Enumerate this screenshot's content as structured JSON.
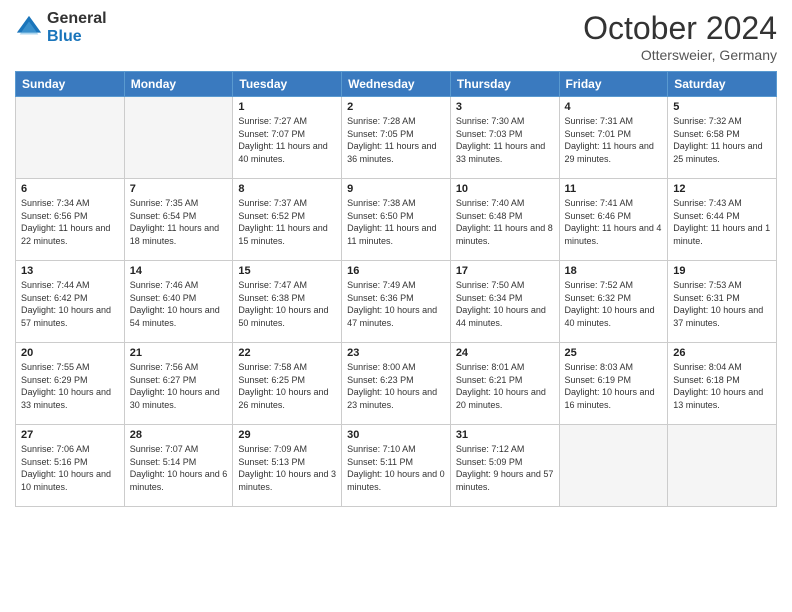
{
  "header": {
    "logo_general": "General",
    "logo_blue": "Blue",
    "month_title": "October 2024",
    "location": "Ottersweier, Germany"
  },
  "days_of_week": [
    "Sunday",
    "Monday",
    "Tuesday",
    "Wednesday",
    "Thursday",
    "Friday",
    "Saturday"
  ],
  "weeks": [
    [
      {
        "day": "",
        "content": ""
      },
      {
        "day": "",
        "content": ""
      },
      {
        "day": "1",
        "content": "Sunrise: 7:27 AM\nSunset: 7:07 PM\nDaylight: 11 hours and 40 minutes."
      },
      {
        "day": "2",
        "content": "Sunrise: 7:28 AM\nSunset: 7:05 PM\nDaylight: 11 hours and 36 minutes."
      },
      {
        "day": "3",
        "content": "Sunrise: 7:30 AM\nSunset: 7:03 PM\nDaylight: 11 hours and 33 minutes."
      },
      {
        "day": "4",
        "content": "Sunrise: 7:31 AM\nSunset: 7:01 PM\nDaylight: 11 hours and 29 minutes."
      },
      {
        "day": "5",
        "content": "Sunrise: 7:32 AM\nSunset: 6:58 PM\nDaylight: 11 hours and 25 minutes."
      }
    ],
    [
      {
        "day": "6",
        "content": "Sunrise: 7:34 AM\nSunset: 6:56 PM\nDaylight: 11 hours and 22 minutes."
      },
      {
        "day": "7",
        "content": "Sunrise: 7:35 AM\nSunset: 6:54 PM\nDaylight: 11 hours and 18 minutes."
      },
      {
        "day": "8",
        "content": "Sunrise: 7:37 AM\nSunset: 6:52 PM\nDaylight: 11 hours and 15 minutes."
      },
      {
        "day": "9",
        "content": "Sunrise: 7:38 AM\nSunset: 6:50 PM\nDaylight: 11 hours and 11 minutes."
      },
      {
        "day": "10",
        "content": "Sunrise: 7:40 AM\nSunset: 6:48 PM\nDaylight: 11 hours and 8 minutes."
      },
      {
        "day": "11",
        "content": "Sunrise: 7:41 AM\nSunset: 6:46 PM\nDaylight: 11 hours and 4 minutes."
      },
      {
        "day": "12",
        "content": "Sunrise: 7:43 AM\nSunset: 6:44 PM\nDaylight: 11 hours and 1 minute."
      }
    ],
    [
      {
        "day": "13",
        "content": "Sunrise: 7:44 AM\nSunset: 6:42 PM\nDaylight: 10 hours and 57 minutes."
      },
      {
        "day": "14",
        "content": "Sunrise: 7:46 AM\nSunset: 6:40 PM\nDaylight: 10 hours and 54 minutes."
      },
      {
        "day": "15",
        "content": "Sunrise: 7:47 AM\nSunset: 6:38 PM\nDaylight: 10 hours and 50 minutes."
      },
      {
        "day": "16",
        "content": "Sunrise: 7:49 AM\nSunset: 6:36 PM\nDaylight: 10 hours and 47 minutes."
      },
      {
        "day": "17",
        "content": "Sunrise: 7:50 AM\nSunset: 6:34 PM\nDaylight: 10 hours and 44 minutes."
      },
      {
        "day": "18",
        "content": "Sunrise: 7:52 AM\nSunset: 6:32 PM\nDaylight: 10 hours and 40 minutes."
      },
      {
        "day": "19",
        "content": "Sunrise: 7:53 AM\nSunset: 6:31 PM\nDaylight: 10 hours and 37 minutes."
      }
    ],
    [
      {
        "day": "20",
        "content": "Sunrise: 7:55 AM\nSunset: 6:29 PM\nDaylight: 10 hours and 33 minutes."
      },
      {
        "day": "21",
        "content": "Sunrise: 7:56 AM\nSunset: 6:27 PM\nDaylight: 10 hours and 30 minutes."
      },
      {
        "day": "22",
        "content": "Sunrise: 7:58 AM\nSunset: 6:25 PM\nDaylight: 10 hours and 26 minutes."
      },
      {
        "day": "23",
        "content": "Sunrise: 8:00 AM\nSunset: 6:23 PM\nDaylight: 10 hours and 23 minutes."
      },
      {
        "day": "24",
        "content": "Sunrise: 8:01 AM\nSunset: 6:21 PM\nDaylight: 10 hours and 20 minutes."
      },
      {
        "day": "25",
        "content": "Sunrise: 8:03 AM\nSunset: 6:19 PM\nDaylight: 10 hours and 16 minutes."
      },
      {
        "day": "26",
        "content": "Sunrise: 8:04 AM\nSunset: 6:18 PM\nDaylight: 10 hours and 13 minutes."
      }
    ],
    [
      {
        "day": "27",
        "content": "Sunrise: 7:06 AM\nSunset: 5:16 PM\nDaylight: 10 hours and 10 minutes."
      },
      {
        "day": "28",
        "content": "Sunrise: 7:07 AM\nSunset: 5:14 PM\nDaylight: 10 hours and 6 minutes."
      },
      {
        "day": "29",
        "content": "Sunrise: 7:09 AM\nSunset: 5:13 PM\nDaylight: 10 hours and 3 minutes."
      },
      {
        "day": "30",
        "content": "Sunrise: 7:10 AM\nSunset: 5:11 PM\nDaylight: 10 hours and 0 minutes."
      },
      {
        "day": "31",
        "content": "Sunrise: 7:12 AM\nSunset: 5:09 PM\nDaylight: 9 hours and 57 minutes."
      },
      {
        "day": "",
        "content": ""
      },
      {
        "day": "",
        "content": ""
      }
    ]
  ]
}
